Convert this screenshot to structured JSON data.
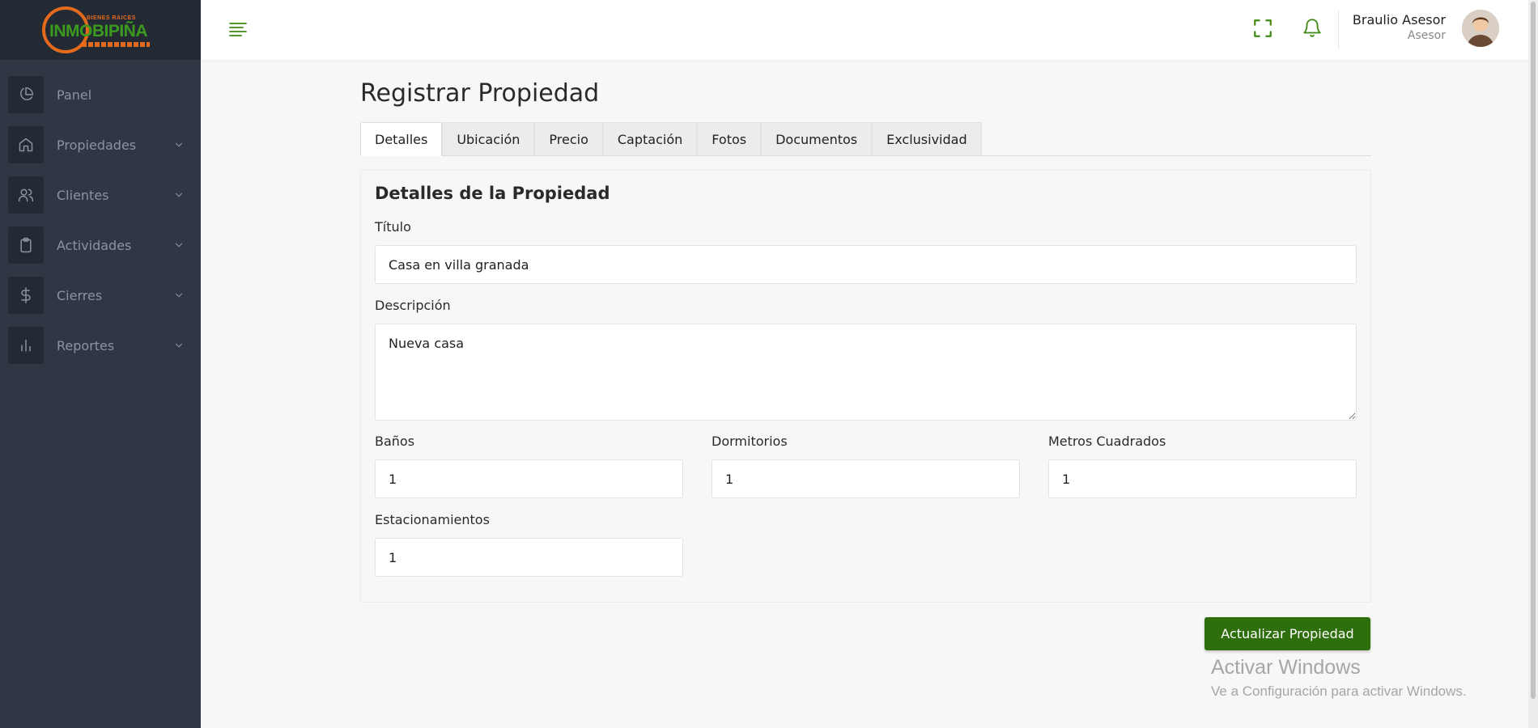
{
  "brand": {
    "tagline": "BIENES RAICES",
    "name": "INMOBIPIÑA"
  },
  "sidebar": {
    "items": [
      {
        "label": "Panel",
        "icon": "pie-chart-icon"
      },
      {
        "label": "Propiedades",
        "icon": "home-icon"
      },
      {
        "label": "Clientes",
        "icon": "users-icon"
      },
      {
        "label": "Actividades",
        "icon": "clipboard-icon"
      },
      {
        "label": "Cierres",
        "icon": "dollar-icon"
      },
      {
        "label": "Reportes",
        "icon": "bar-chart-icon"
      }
    ]
  },
  "header": {
    "user_name": "Braulio Asesor",
    "user_role": "Asesor"
  },
  "page": {
    "title": "Registrar Propiedad"
  },
  "tabs": [
    {
      "label": "Detalles",
      "active": true
    },
    {
      "label": "Ubicación"
    },
    {
      "label": "Precio"
    },
    {
      "label": "Captación"
    },
    {
      "label": "Fotos"
    },
    {
      "label": "Documentos"
    },
    {
      "label": "Exclusividad"
    }
  ],
  "form": {
    "section_title": "Detalles de la Propiedad",
    "titulo_label": "Título",
    "titulo_value": "Casa en villa granada",
    "descripcion_label": "Descripción",
    "descripcion_value": "Nueva casa",
    "banos_label": "Baños",
    "banos_value": "1",
    "dormitorios_label": "Dormitorios",
    "dormitorios_value": "1",
    "metros_label": "Metros Cuadrados",
    "metros_value": "1",
    "estacionamientos_label": "Estacionamientos",
    "estacionamientos_value": "1",
    "submit_label": "Actualizar Propiedad"
  },
  "watermark": {
    "title": "Activar Windows",
    "subtitle": "Ve a Configuración para activar Windows."
  },
  "colors": {
    "sidebar_bg": "#2f3744",
    "accent_green": "#2e6e0d",
    "icon_green": "#3f8a13",
    "brand_orange": "#e46a1c"
  }
}
